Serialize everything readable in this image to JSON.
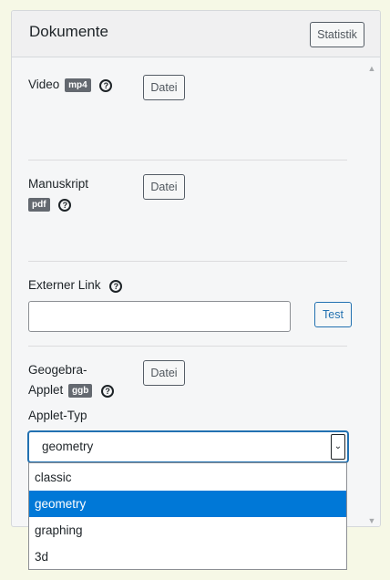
{
  "panel": {
    "title": "Dokumente",
    "stat_button": "Statistik"
  },
  "video": {
    "label": "Video",
    "badge": "mp4",
    "help": "?",
    "file_button": "Datei"
  },
  "manuskript": {
    "label": "Manuskript",
    "badge": "pdf",
    "help": "?",
    "file_button": "Datei"
  },
  "external_link": {
    "label": "Externer Link",
    "help": "?",
    "value": "",
    "test_button": "Test"
  },
  "geogebra": {
    "label_line1": "Geogebra-",
    "label_line2": "Applet",
    "badge": "ggb",
    "help": "?",
    "file_button": "Datei",
    "type_label": "Applet-Typ",
    "selected": "geometry",
    "options": [
      "classic",
      "geometry",
      "graphing",
      "3d"
    ]
  },
  "scrollbar": {
    "up": "▲",
    "down": "▼"
  },
  "select_arrow_glyph": "⌄"
}
